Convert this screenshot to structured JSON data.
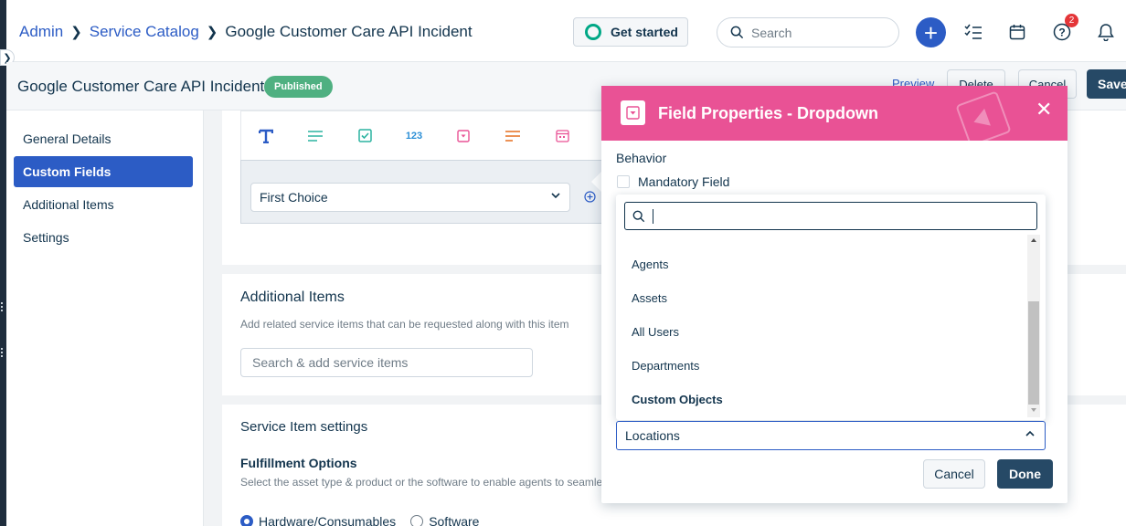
{
  "breadcrumb": {
    "items": [
      "Admin",
      "Service Catalog"
    ],
    "current": "Google Customer Care API Incident"
  },
  "header": {
    "get_started_label": "Get started",
    "search_placeholder": "Search",
    "notification_count": "2"
  },
  "subheader": {
    "title": "Google Customer Care API Incident",
    "status": "Published",
    "preview_label": "Preview",
    "delete_label": "Delete",
    "cancel_label": "Cancel",
    "save_label": "Save"
  },
  "sidebar": {
    "items": [
      {
        "label": "General Details"
      },
      {
        "label": "Custom Fields"
      },
      {
        "label": "Additional Items"
      },
      {
        "label": "Settings"
      }
    ],
    "active": "Custom Fields"
  },
  "custom_fields": {
    "toolbar_icons": [
      "text-icon",
      "paragraph-icon",
      "checkbox-icon",
      "number-icon",
      "dropdown-icon",
      "multi-select-icon",
      "date-icon"
    ],
    "number_tool_label": "123",
    "choice_value": "First Choice"
  },
  "additional_items": {
    "title": "Additional Items",
    "description": "Add related service items that can be requested along with this item",
    "search_placeholder": "Search & add service items"
  },
  "service_settings": {
    "title": "Service Item settings",
    "fulfillment_heading": "Fulfillment Options",
    "fulfillment_desc": "Select the asset type & product or the software to enable agents to seamle",
    "options": [
      "Hardware/Consumables",
      "Software"
    ],
    "selected": "Hardware/Consumables"
  },
  "modal": {
    "title": "Field Properties - Dropdown",
    "behavior_label": "Behavior",
    "mandatory_label": "Mandatory Field",
    "mandatory_checked": false,
    "search_value": "",
    "list_items": [
      {
        "label": "Agents",
        "bold": false
      },
      {
        "label": "Assets",
        "bold": false
      },
      {
        "label": "All Users",
        "bold": false
      },
      {
        "label": "Departments",
        "bold": false
      },
      {
        "label": "Custom Objects",
        "bold": true
      }
    ],
    "selected_value": "Locations",
    "cancel_label": "Cancel",
    "done_label": "Done"
  },
  "colors": {
    "accent": "#2c5cc5",
    "modal_header": "#e95295",
    "primary_button": "#264966",
    "published": "#4fb081",
    "badge": "#e43538"
  }
}
